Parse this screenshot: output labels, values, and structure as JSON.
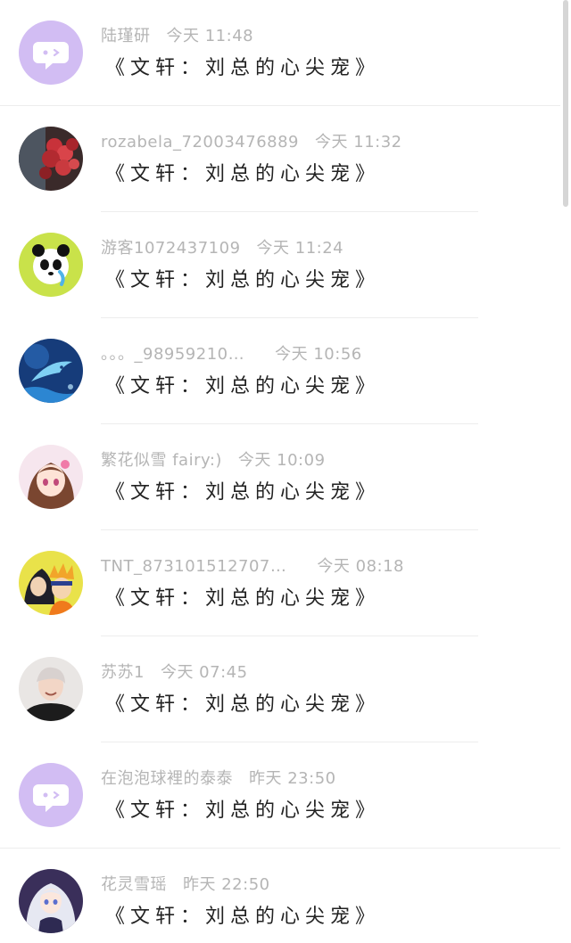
{
  "comments": [
    {
      "name": "陆瑾研",
      "time": "今天 11:48",
      "book": "《文轩：刘总的心尖宠》",
      "avatar": "chat-bubble-icon"
    },
    {
      "name": "rozabela_72003476889",
      "time": "今天 11:32",
      "book": "《文轩：刘总的心尖宠》",
      "avatar": "flower-photo"
    },
    {
      "name": "游客1072437109",
      "time": "今天 11:24",
      "book": "《文轩：刘总的心尖宠》",
      "avatar": "panda-cartoon"
    },
    {
      "name": "。。。_98959210…",
      "time": "今天 10:56",
      "book": "《文轩：刘总的心尖宠》",
      "avatar": "dolphin-art"
    },
    {
      "name": "繁花似雪 fairy:)",
      "time": "今天 10:09",
      "book": "《文轩：刘总的心尖宠》",
      "avatar": "anime-girl"
    },
    {
      "name": "TNT_873101512707…",
      "time": "今天 08:18",
      "book": "《文轩：刘总的心尖宠》",
      "avatar": "anime-duo"
    },
    {
      "name": "苏苏1",
      "time": "今天 07:45",
      "book": "《文轩：刘总的心尖宠》",
      "avatar": "person-photo"
    },
    {
      "name": "在泡泡球裡的泰泰",
      "time": "昨天 23:50",
      "book": "《文轩：刘总的心尖宠》",
      "avatar": "chat-bubble-icon"
    },
    {
      "name": "花灵雪瑶",
      "time": "昨天 22:50",
      "book": "《文轩：刘总的心尖宠》",
      "avatar": "anime-princess"
    }
  ],
  "colors": {
    "meta_text": "#b5b5b5",
    "title_text": "#222222",
    "default_avatar_bg": "#d2bdf3",
    "divider": "#ededed"
  }
}
